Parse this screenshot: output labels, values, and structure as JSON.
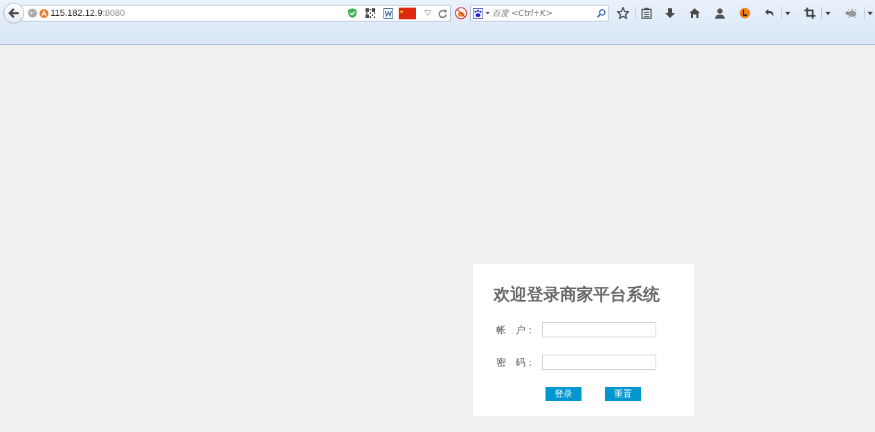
{
  "browser": {
    "url_host": "115.182.12.9",
    "url_port": ":8080",
    "search_placeholder": "百度 <Ctrl+K>"
  },
  "login": {
    "title": "欢迎登录商家平台系统",
    "fields": [
      {
        "label": "帐　户："
      },
      {
        "label": "密　码："
      }
    ],
    "buttons": [
      "登录",
      "重置"
    ]
  }
}
